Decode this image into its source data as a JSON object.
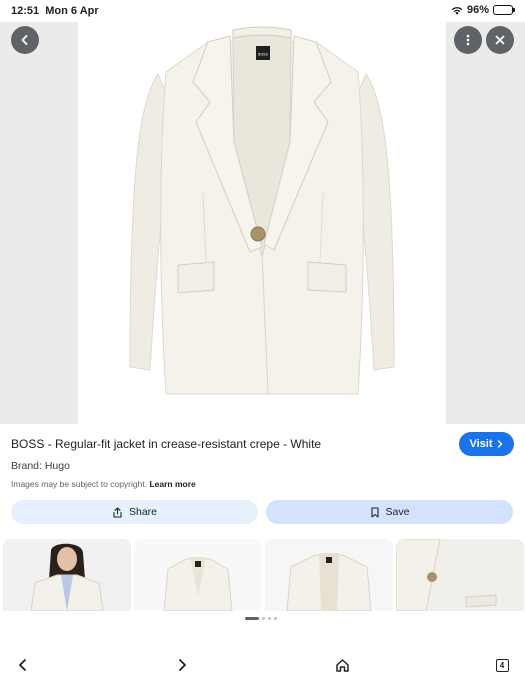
{
  "status_bar": {
    "time": "12:51",
    "date": "Mon 6 Apr",
    "battery": "96%",
    "battery_level": 0.96
  },
  "toolbar": {
    "back_icon": "chevron-left-icon",
    "more_icon": "more-vertical-icon",
    "close_icon": "close-icon"
  },
  "product": {
    "title": "BOSS - Regular-fit jacket in crease-resistant crepe - White",
    "visit_label": "Visit",
    "brand": "Brand: Hugo",
    "copyright": "Images may be subject to copyright.",
    "learn_more": "Learn more",
    "jacket_label": "BOSS"
  },
  "actions": {
    "share_label": "Share",
    "save_label": "Save"
  },
  "thumbnails": [
    {
      "alt": "model wearing white blazer"
    },
    {
      "alt": "white blazer front"
    },
    {
      "alt": "white blazer open"
    },
    {
      "alt": "blazer detail"
    }
  ],
  "pagination": {
    "total": 4,
    "current": 1
  },
  "bottom_nav": {
    "tabs_count": "4"
  },
  "colors": {
    "accent": "#1a73e8",
    "share_bg": "#e8f0fe",
    "save_bg": "#d3e3fd",
    "jacket": "#f4f2ea"
  }
}
